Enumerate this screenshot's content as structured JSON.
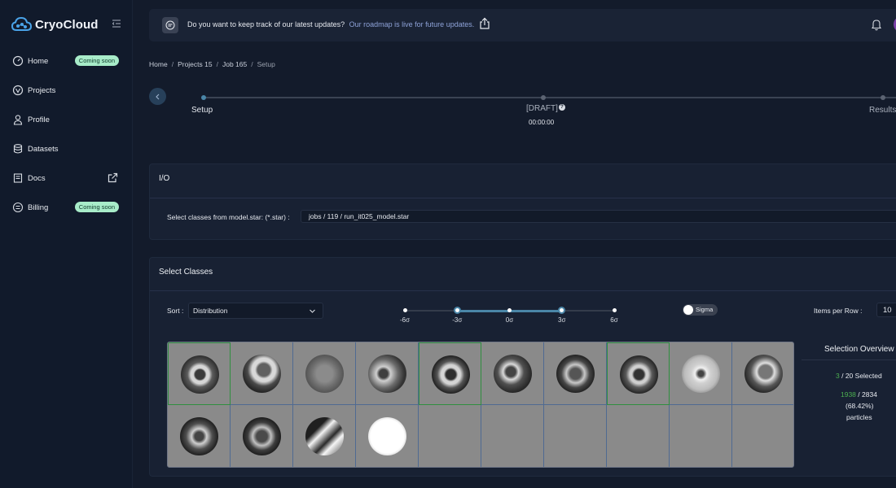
{
  "brand": {
    "name": "CryoCloud"
  },
  "sidebar": {
    "items": [
      {
        "label": "Home",
        "badge": "Coming soon",
        "icon": "gauge-icon"
      },
      {
        "label": "Projects",
        "icon": "shield-icon"
      },
      {
        "label": "Profile",
        "icon": "user-icon"
      },
      {
        "label": "Datasets",
        "icon": "database-icon"
      },
      {
        "label": "Docs",
        "icon": "book-icon"
      },
      {
        "label": "Billing",
        "badge": "Coming soon",
        "icon": "receipt-icon"
      }
    ]
  },
  "banner": {
    "text": "Do you want to keep track of our latest updates?",
    "link": "Our roadmap is live for future updates."
  },
  "breadcrumb": {
    "home": "Home",
    "project": "Projects 15",
    "job": "Job 165",
    "current": "Setup",
    "separator": "/"
  },
  "stepper": {
    "steps": [
      "Setup",
      "[DRAFT]",
      "Results"
    ],
    "help_glyph": "?",
    "time": "00:00:00"
  },
  "io": {
    "title": "I/O",
    "label": "Select classes from model.star: (*.star) :",
    "value": "jobs / 119 / run_it025_model.star"
  },
  "select_classes": {
    "title": "Select Classes",
    "sort_label": "Sort :",
    "sort_value": "Distribution",
    "sigma_ticks": [
      "-6σ",
      "-3σ",
      "0σ",
      "3σ",
      "6σ"
    ],
    "sigma_range": [
      -3,
      3
    ],
    "sigma_toggle_label": "Sigma",
    "items_per_row_label": "Items per Row  :",
    "items_per_row_value": "10",
    "thumbnails": [
      {
        "selected": true
      },
      {
        "selected": false
      },
      {
        "selected": false
      },
      {
        "selected": false
      },
      {
        "selected": true
      },
      {
        "selected": false
      },
      {
        "selected": false
      },
      {
        "selected": true
      },
      {
        "selected": false
      },
      {
        "selected": false
      },
      {
        "selected": false
      },
      {
        "selected": false
      },
      {
        "selected": false
      },
      {
        "selected": false
      }
    ]
  },
  "overview": {
    "title": "Selection Overview",
    "selected_count": "3",
    "selected_suffix": "/ 20 Selected",
    "particles_selected": "1938",
    "particles_suffix": "/ 2834",
    "percent": "(68.42%)",
    "particles_label": "particles"
  },
  "colors": {
    "accent": "#4a86a8",
    "badge": "#a8ecc9",
    "selected": "#2f8f3f",
    "link": "#8ea2d8"
  }
}
